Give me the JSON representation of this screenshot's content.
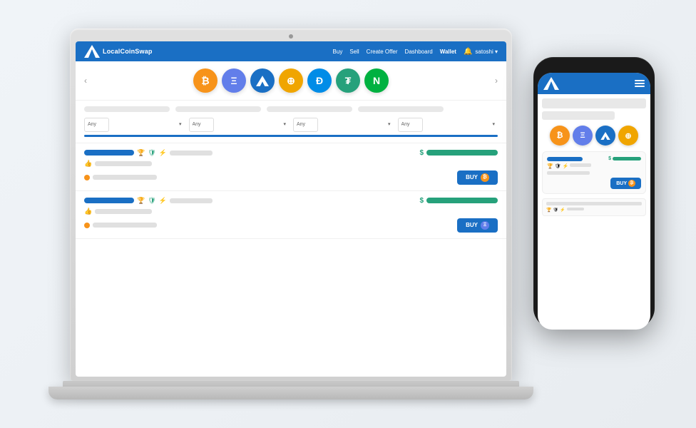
{
  "app": {
    "name": "LocalCoinSwap"
  },
  "nav": {
    "logo_text": "LocalCoinSwap",
    "links": [
      "Buy",
      "Sell",
      "Create Offer",
      "Dashboard",
      "Wallet"
    ],
    "wallet_label": "Wallet",
    "bell": "🔔",
    "user": "satoshi ▾"
  },
  "coins": [
    {
      "id": "btc",
      "symbol": "₿",
      "color": "#f7931a",
      "label": "Bitcoin"
    },
    {
      "id": "eth",
      "symbol": "Ξ",
      "color": "#627eea",
      "label": "Ethereum"
    },
    {
      "id": "lcs",
      "symbol": "⬟",
      "color": "#1a6fc4",
      "label": "LocalCoinSwap"
    },
    {
      "id": "dash_y",
      "symbol": "⊕",
      "color": "#f7931a",
      "label": "Token"
    },
    {
      "id": "dash",
      "symbol": "Đ",
      "color": "#008ce7",
      "label": "Dash"
    },
    {
      "id": "usdt",
      "symbol": "₮",
      "color": "#26a17b",
      "label": "Tether"
    },
    {
      "id": "neo",
      "symbol": "N",
      "color": "#00b140",
      "label": "NEO"
    }
  ],
  "listings": [
    {
      "seller_bar_width": 70,
      "has_trophy": true,
      "has_shield": true,
      "has_bolt": true,
      "price_bar_width": 100,
      "coin_type": "btc",
      "coin_color": "#f7931a"
    },
    {
      "seller_bar_width": 70,
      "has_trophy": true,
      "has_shield": true,
      "has_bolt": true,
      "price_bar_width": 100,
      "coin_type": "eth",
      "coin_color": "#627eea"
    }
  ],
  "buy_label": "BUY",
  "filters": {
    "placeholders": [
      "",
      "",
      "",
      ""
    ],
    "select_options": [
      "Any",
      "Any",
      "Any",
      "Any"
    ]
  },
  "mobile": {
    "coins": [
      {
        "symbol": "₿",
        "color": "#f7931a"
      },
      {
        "symbol": "Ξ",
        "color": "#627eea"
      },
      {
        "symbol": "⬟",
        "color": "#1a6fc4"
      },
      {
        "symbol": "⊕",
        "color": "#f7931a"
      }
    ]
  }
}
